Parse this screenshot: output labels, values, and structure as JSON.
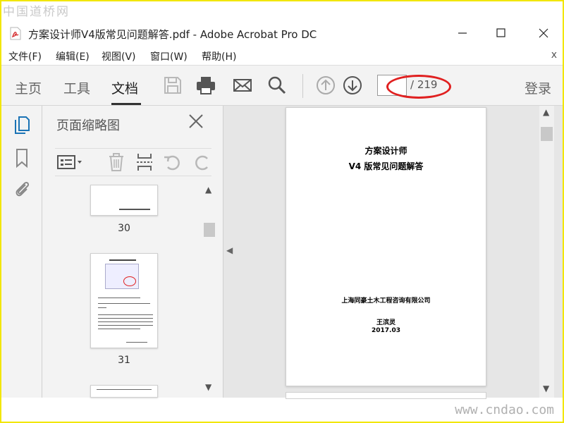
{
  "watermarks": {
    "top": "中国道桥网",
    "bottom": "www.cndao.com"
  },
  "window": {
    "title": "方案设计师V4版常见问题解答.pdf - Adobe Acrobat Pro DC",
    "icon": "pdf-file-icon"
  },
  "menu": {
    "items": [
      "文件(F)",
      "编辑(E)",
      "视图(V)",
      "窗口(W)",
      "帮助(H)"
    ],
    "close": "x"
  },
  "toolbar": {
    "tabs": [
      "主页",
      "工具",
      "文档"
    ],
    "active_tab": "文档",
    "page_input_value": "",
    "page_total": "/ 219",
    "login": "登录"
  },
  "thumbnails_panel": {
    "title": "页面缩略图",
    "pages": [
      "30",
      "31"
    ]
  },
  "document": {
    "title_line1": "方案设计师",
    "title_line2": "V4 版常见问题解答",
    "company": "上海同豪土木工程咨询有限公司",
    "author": "王滨灵",
    "date": "2017.03"
  },
  "colors": {
    "accent": "#1a73b5",
    "highlight_oval": "#e02020",
    "frame": "#f2e600"
  }
}
